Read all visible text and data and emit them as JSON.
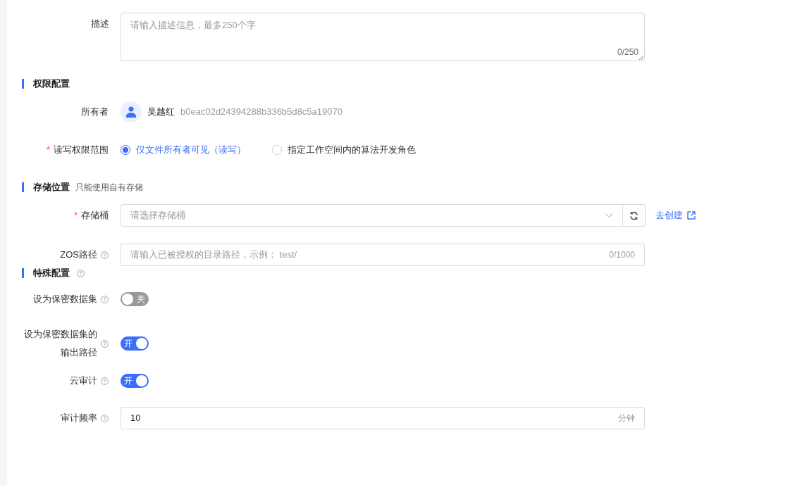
{
  "description": {
    "label": "描述",
    "placeholder": "请输入描述信息，最多250个字",
    "counter": "0/250"
  },
  "sections": [
    {
      "title": "权限配置",
      "items": [
        {
          "kind": "owner",
          "label": "所有者",
          "help": false,
          "name": "吴越红",
          "id": "b0eac02d24394288b336b5d8c5a19070"
        },
        {
          "kind": "radio",
          "label": "读写权限范围",
          "marker": "*",
          "help": false,
          "options": [
            {
              "label": "仅文件所有者可见（读写）",
              "selected": true
            },
            {
              "label": "指定工作空间内的算法开发角色",
              "selected": false
            }
          ]
        }
      ]
    },
    {
      "title": "存储位置",
      "note": "只能使用自有存储",
      "items": [
        {
          "kind": "select",
          "label": "存储桶",
          "marker": "*",
          "help": false,
          "placeholder": "请选择存储桶",
          "link": "去创建"
        },
        {
          "kind": "input",
          "label": "ZOS路径",
          "help": true,
          "placeholder": "请输入已被授权的目录路径，示例： test/",
          "counter": "0/1000"
        }
      ]
    },
    {
      "title": "特殊配置",
      "help": true,
      "items": [
        {
          "kind": "switch",
          "label": "设为保密数据集",
          "help": true,
          "on": false,
          "text": "关"
        },
        {
          "kind": "switch",
          "label": "设为保密数据集的输出路径",
          "help": true,
          "on": true,
          "text": "开"
        },
        {
          "kind": "switch",
          "label": "云审计",
          "help": true,
          "on": true,
          "text": "开"
        },
        {
          "kind": "input",
          "label": "审计频率",
          "help": true,
          "value": "10",
          "suffix": "分钟"
        }
      ]
    }
  ]
}
